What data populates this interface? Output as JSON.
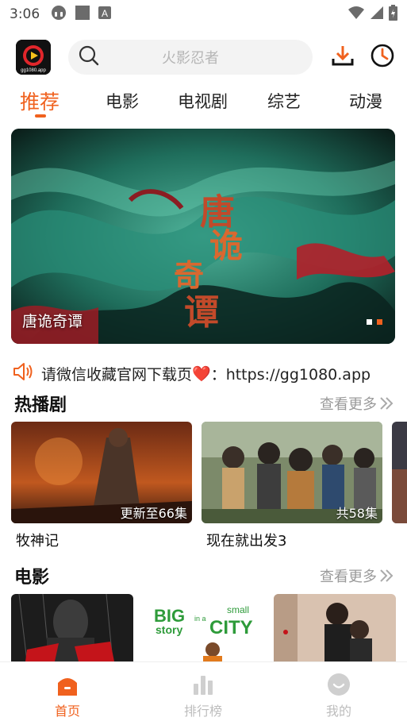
{
  "status_bar": {
    "time": "3:06"
  },
  "header": {
    "logo_text": "gg1080.app",
    "search_placeholder": "火影忍者",
    "accent_color": "#f0611e"
  },
  "tabs": [
    {
      "label": "推荐",
      "active": true
    },
    {
      "label": "电影",
      "active": false
    },
    {
      "label": "电视剧",
      "active": false
    },
    {
      "label": "综艺",
      "active": false
    },
    {
      "label": "动漫",
      "active": false
    }
  ],
  "banner": {
    "title": "唐诡奇谭",
    "art_text": [
      "唐",
      "诡",
      "奇",
      "谭"
    ],
    "page_count": 2,
    "active_page": 2
  },
  "notice": {
    "text": "请微信收藏官网下载页",
    "heart": "❤️",
    "url_text": "：https://gg1080.app"
  },
  "sections": [
    {
      "title": "热播剧",
      "more_label": "查看更多",
      "items": [
        {
          "title": "牧神记",
          "badge": "更新至66集"
        },
        {
          "title": "现在就出发3",
          "badge": "共58集"
        }
      ]
    },
    {
      "title": "电影",
      "more_label": "查看更多",
      "items": [
        {
          "title": "",
          "badge": ""
        },
        {
          "title": "",
          "badge": "",
          "poster_text": [
            "BIG",
            "small",
            "story",
            "in a",
            "CITY"
          ]
        },
        {
          "title": "",
          "badge": ""
        }
      ]
    }
  ],
  "bottom_nav": [
    {
      "label": "首页",
      "icon": "home-icon",
      "active": true
    },
    {
      "label": "排行榜",
      "icon": "chart-icon",
      "active": false
    },
    {
      "label": "我的",
      "icon": "profile-icon",
      "active": false
    }
  ]
}
